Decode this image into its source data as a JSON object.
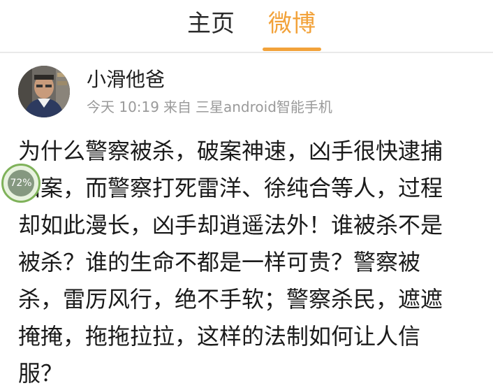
{
  "tabs": {
    "home_label": "主页",
    "weibo_label": "微博",
    "active": "微博",
    "accent_color": "#f2a23a"
  },
  "post": {
    "username": "小滑他爸",
    "time": "今天 10:19",
    "source_prefix": "来自",
    "source": "三星android智能手机",
    "body_lines": [
      "为什么警察被杀，破案神速，凶手很快逮捕",
      "归案，而警察打死雷洋、徐纯合等人，过程",
      "却如此漫长，凶手却逍遥法外！谁被杀不是",
      "被杀？谁的生命不都是一样可贵？警察被",
      "杀，雷厉风行，绝不手软；警察杀民，遮遮",
      "掩掩，拖拖拉拉，这样的法制如何让人信",
      "服？"
    ]
  },
  "floating_widget": {
    "label": "72%"
  }
}
